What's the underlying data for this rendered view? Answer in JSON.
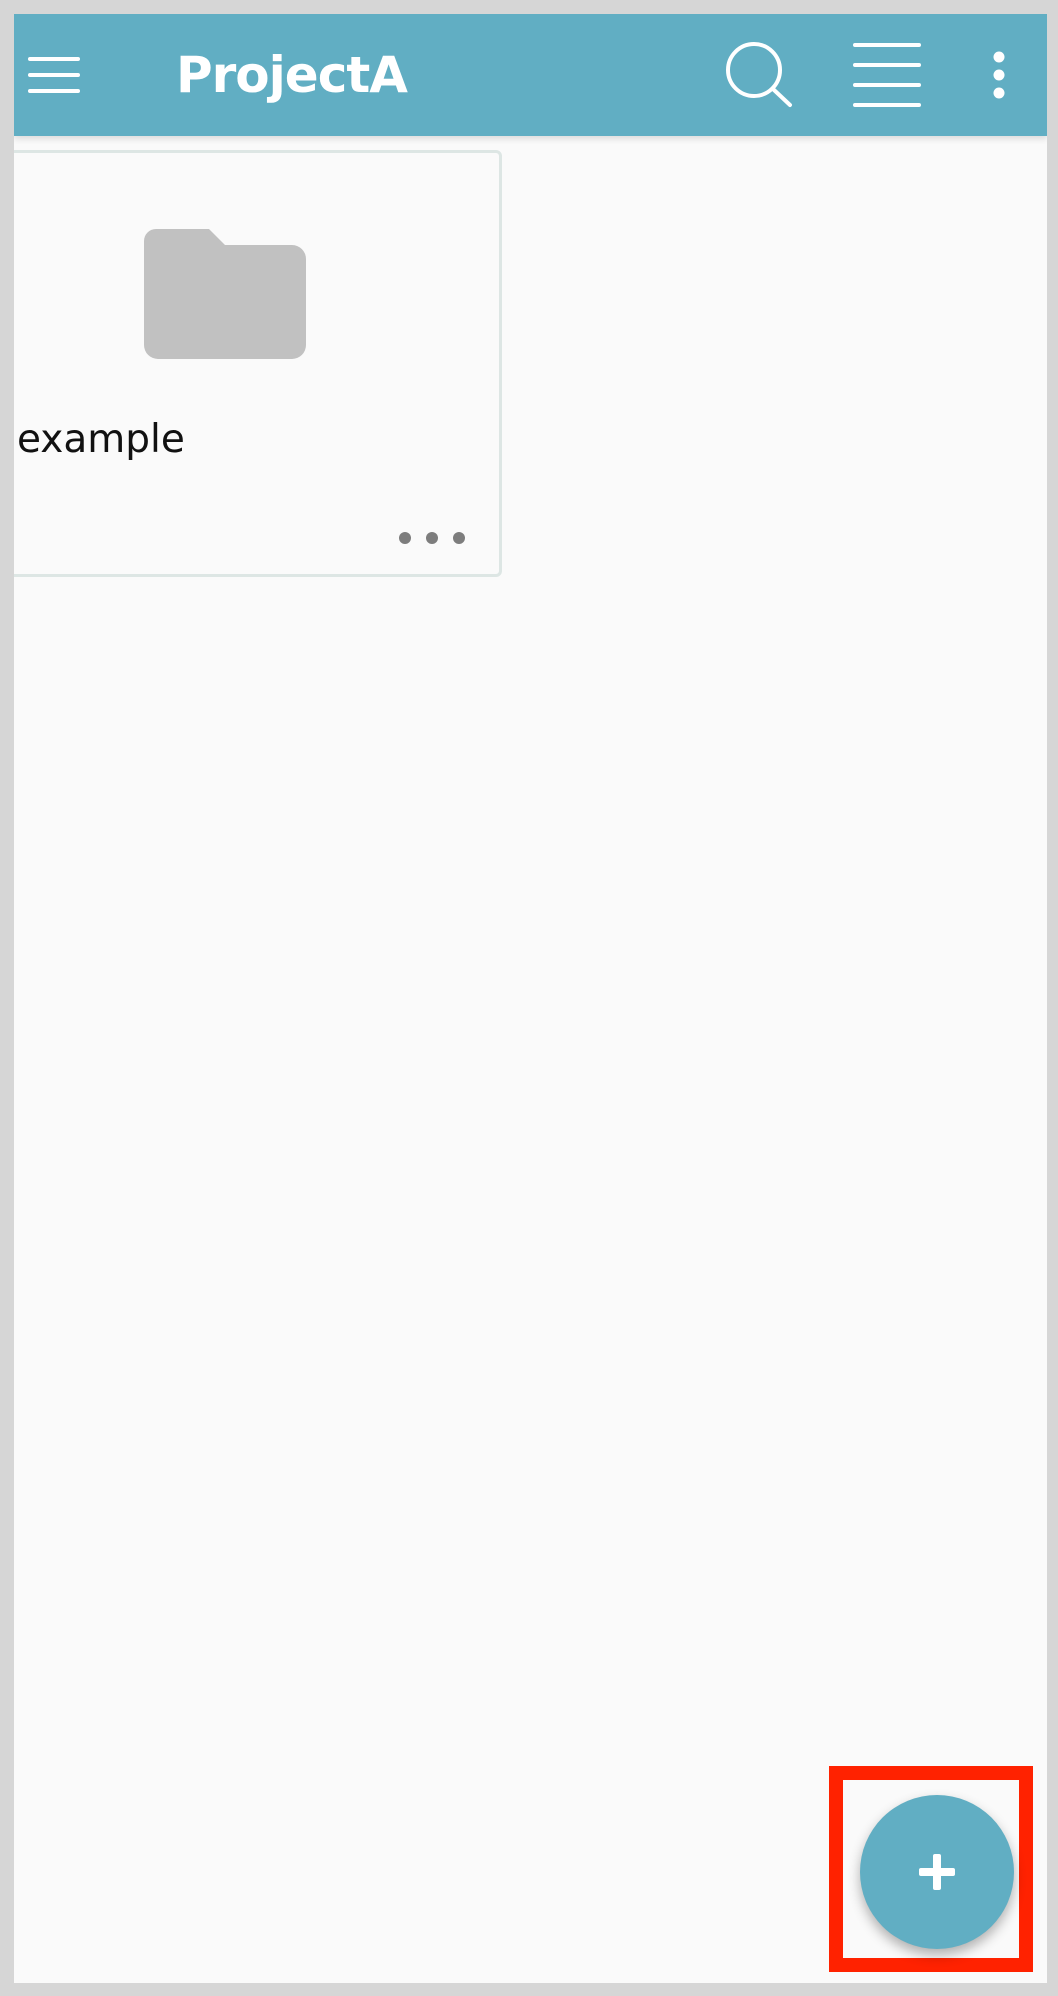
{
  "app_bar": {
    "title": "ProjectA",
    "color": "#61aec3",
    "icons": {
      "menu": "menu-icon",
      "search": "search-icon",
      "view": "list-view-icon",
      "more": "more-vertical-icon"
    }
  },
  "content": {
    "items": [
      {
        "label": "example",
        "icon": "folder-icon",
        "more_icon": "more-horizontal-icon"
      }
    ]
  },
  "fab": {
    "icon": "plus-icon",
    "color": "#61aec3",
    "highlight_color": "#ff2200"
  }
}
